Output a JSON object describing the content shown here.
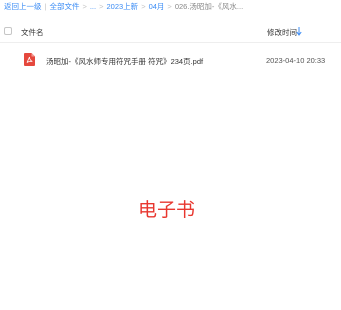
{
  "breadcrumb": {
    "back": "返回上一级",
    "sep1": "|",
    "all_files": "全部文件",
    "sep2": ">",
    "ellipsis": "...",
    "sep3": ">",
    "crumb1": "2023上新",
    "sep4": ">",
    "crumb2": "04月",
    "sep5": ">",
    "current": "026.汤昭加-《风水..."
  },
  "table": {
    "col_name": "文件名",
    "col_time": "修改时间",
    "sort_icon": "sort-arrow-down-icon"
  },
  "files": [
    {
      "icon": "pdf-file-icon",
      "name": "汤昭加-《风水师专用符咒手册 符咒》234页.pdf",
      "time": "2023-04-10 20:33"
    }
  ],
  "watermark": "电子书",
  "colors": {
    "accent": "#3b8cf5",
    "pdf": "#e5483d",
    "watermark": "#e8372f"
  }
}
